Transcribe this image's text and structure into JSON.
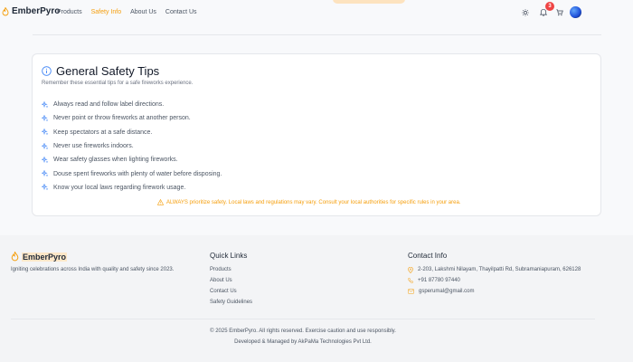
{
  "header": {
    "brand": "EmberPyro",
    "nav": [
      {
        "label": "Products",
        "active": false
      },
      {
        "label": "Safety Info",
        "active": true
      },
      {
        "label": "About Us",
        "active": false
      },
      {
        "label": "Contact Us",
        "active": false
      }
    ],
    "cart_count": "3",
    "icons": [
      "flame-icon",
      "sun-icon",
      "bell-icon",
      "cart-icon",
      "avatar"
    ]
  },
  "card": {
    "title": "General Safety Tips",
    "subtitle": "Remember these essential tips for a safe fireworks experience.",
    "tips": [
      "Always read and follow label directions.",
      "Never point or throw fireworks at another person.",
      "Keep spectators at a safe distance.",
      "Never use fireworks indoors.",
      "Wear safety glasses when lighting fireworks.",
      "Douse spent fireworks with plenty of water before disposing.",
      "Know your local laws regarding firework usage."
    ],
    "warning": "ALWAYS prioritize safety. Local laws and regulations may vary. Consult your local authorities for specific rules in your area."
  },
  "footer": {
    "brand": "EmberPyro",
    "tagline": "Igniting celebrations across India with quality and safety since 2023.",
    "quick_links_title": "Quick Links",
    "quick_links": [
      "Products",
      "About Us",
      "Contact Us",
      "Safety Guidelines"
    ],
    "contact_title": "Contact Info",
    "contact": {
      "address": "2-203, Lakshmi Nilayam, Thayilpatti Rd, Subramaniapuram, 626128",
      "phone": "+91 87780 97440",
      "email": "gsperumal@gmail.com"
    },
    "copyright": "© 2025 EmberPyro. All rights reserved. Exercise caution and use responsibly.",
    "developer": "Developed & Managed by AkPaMa Technologies Pvt Ltd."
  },
  "colors": {
    "accent": "#f59e0b",
    "primary_blue": "#3b82f6",
    "badge_red": "#ef4444"
  }
}
